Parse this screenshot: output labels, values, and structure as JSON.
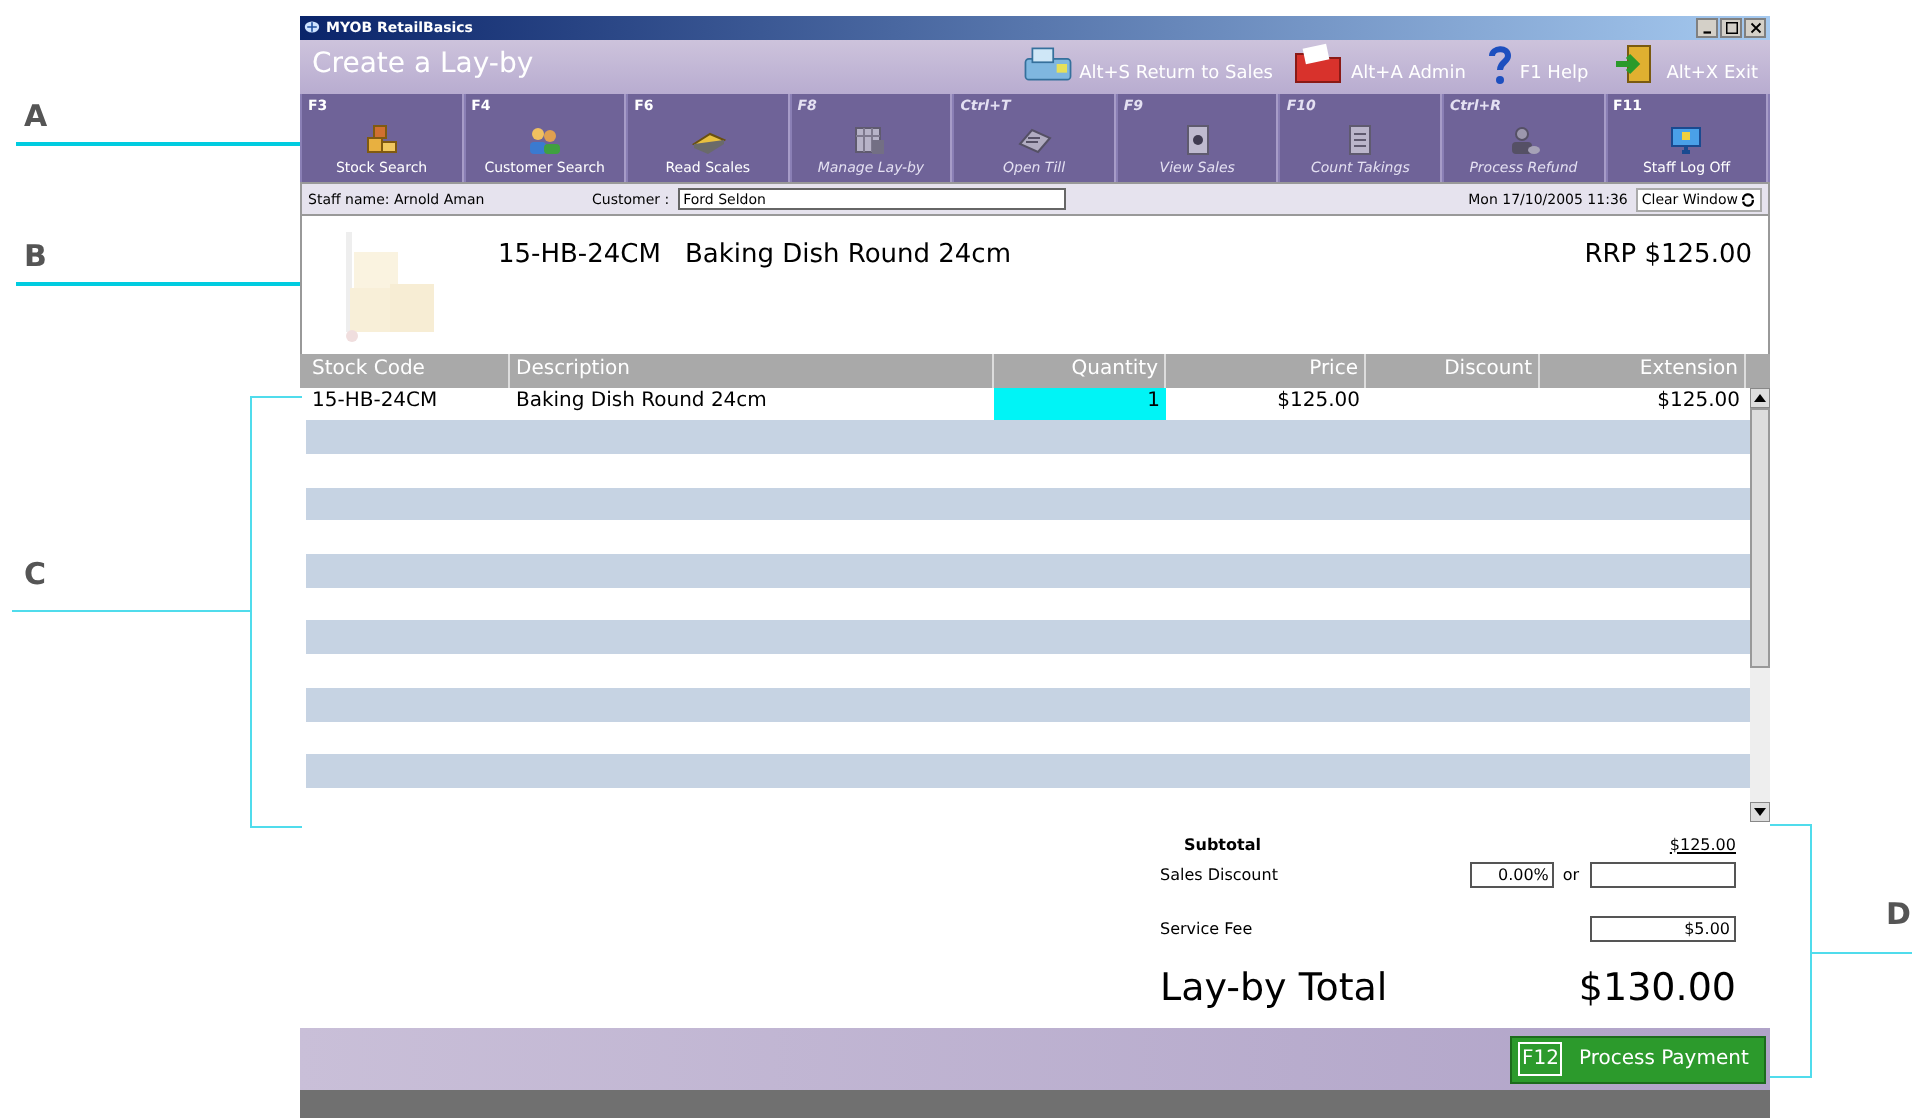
{
  "callouts": [
    {
      "label": "A"
    },
    {
      "label": "B"
    },
    {
      "label": "C"
    },
    {
      "label": "D"
    }
  ],
  "window": {
    "title": "MYOB RetailBasics"
  },
  "header": {
    "title": "Create a Lay-by",
    "shortcuts": [
      {
        "label": "Alt+S Return to Sales",
        "kind": "register"
      },
      {
        "label": "Alt+A Admin",
        "kind": "folder"
      },
      {
        "label": "F1 Help",
        "kind": "help"
      },
      {
        "label": "Alt+X Exit",
        "kind": "exit"
      }
    ]
  },
  "toolbar": [
    {
      "key": "F3",
      "label": "Stock Search",
      "kind": "boxes",
      "disabled": false
    },
    {
      "key": "F4",
      "label": "Customer Search",
      "kind": "people",
      "disabled": false
    },
    {
      "key": "F6",
      "label": "Read Scales",
      "kind": "scale",
      "disabled": false
    },
    {
      "key": "F8",
      "label": "Manage Lay-by",
      "kind": "calendar",
      "disabled": true
    },
    {
      "key": "Ctrl+T",
      "label": "Open Till",
      "kind": "till",
      "disabled": true
    },
    {
      "key": "F9",
      "label": "View Sales",
      "kind": "document",
      "disabled": true
    },
    {
      "key": "F10",
      "label": "Count Takings",
      "kind": "list",
      "disabled": true
    },
    {
      "key": "Ctrl+R",
      "label": "Process Refund",
      "kind": "person",
      "disabled": true
    },
    {
      "key": "F11",
      "label": "Staff Log Off",
      "kind": "monitor",
      "disabled": false
    }
  ],
  "staff_bar": {
    "staff": "Staff name: Arnold Aman",
    "customer_label": "Customer :",
    "customer_value": "Ford Seldon",
    "datetime": "Mon 17/10/2005 11:36",
    "clear_button": "Clear Window"
  },
  "product": {
    "code": "15-HB-24CM",
    "description": "Baking Dish Round 24cm",
    "rrp": "RRP $125.00"
  },
  "table": {
    "columns": [
      "Stock Code",
      "Description",
      "Quantity",
      "Price",
      "Discount",
      "Extension"
    ],
    "rows": [
      {
        "cells": [
          "15-HB-24CM",
          "Baking Dish Round 24cm",
          "1",
          "$125.00",
          "",
          "$125.00"
        ],
        "editing": true
      }
    ]
  },
  "totals": {
    "subtotal_label": "Subtotal",
    "subtotal_value": "$125.00",
    "discount_label": "Sales Discount",
    "discount_percent": "0.00%",
    "or": "or",
    "service_fee_label": "Service Fee",
    "service_fee_value": "$5.00",
    "total_label": "Lay-by Total",
    "total_value": "$130.00"
  },
  "footer": {
    "key": "F12",
    "label": "Process Payment"
  }
}
